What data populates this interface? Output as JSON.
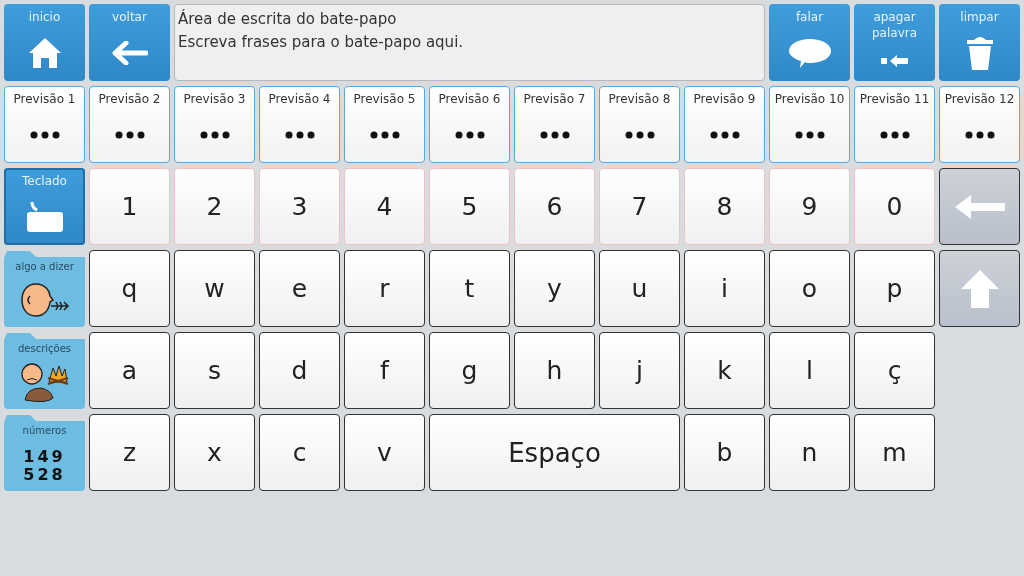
{
  "top_bar": {
    "left": [
      {
        "kind": "home",
        "label": "inicio"
      },
      {
        "kind": "back",
        "label": "voltar"
      }
    ],
    "chat_area": {
      "title": "Área de escrita do bate-papo",
      "placeholder": "Escreva frases para o bate-papo aqui."
    },
    "right": [
      {
        "kind": "speak",
        "label": "falar"
      },
      {
        "kind": "delete-word",
        "label": "apagar palavra"
      },
      {
        "kind": "clear",
        "label": "limpar"
      }
    ]
  },
  "predictions": [
    {
      "label": "Previsão 1"
    },
    {
      "label": "Previsão 2"
    },
    {
      "label": "Previsão 3"
    },
    {
      "label": "Previsão 4"
    },
    {
      "label": "Previsão 5"
    },
    {
      "label": "Previsão 6"
    },
    {
      "label": "Previsão 7"
    },
    {
      "label": "Previsão 8"
    },
    {
      "label": "Previsão 9"
    },
    {
      "label": "Previsão 10"
    },
    {
      "label": "Previsão 11"
    },
    {
      "label": "Previsão 12"
    }
  ],
  "side_menu": [
    {
      "kind": "keyboard",
      "label": "Teclado",
      "selected": true
    },
    {
      "kind": "say",
      "label": "algo a dizer",
      "selected": false
    },
    {
      "kind": "describe",
      "label": "descrições",
      "selected": false
    },
    {
      "kind": "numbers",
      "label": "números",
      "selected": false,
      "digits": [
        "149",
        "528"
      ]
    }
  ],
  "keyboard": [
    {
      "keys": [
        {
          "kind": "digit",
          "text": "1"
        },
        {
          "kind": "digit",
          "text": "2"
        },
        {
          "kind": "digit",
          "text": "3"
        },
        {
          "kind": "digit",
          "text": "4"
        },
        {
          "kind": "digit",
          "text": "5"
        },
        {
          "kind": "digit",
          "text": "6"
        },
        {
          "kind": "digit",
          "text": "7"
        },
        {
          "kind": "digit",
          "text": "8"
        },
        {
          "kind": "digit",
          "text": "9"
        },
        {
          "kind": "digit",
          "text": "0"
        },
        {
          "kind": "backspace"
        }
      ]
    },
    {
      "keys": [
        {
          "kind": "letter",
          "text": "q"
        },
        {
          "kind": "letter",
          "text": "w"
        },
        {
          "kind": "letter",
          "text": "e"
        },
        {
          "kind": "letter",
          "text": "r"
        },
        {
          "kind": "letter",
          "text": "t"
        },
        {
          "kind": "letter",
          "text": "y"
        },
        {
          "kind": "letter",
          "text": "u"
        },
        {
          "kind": "letter",
          "text": "i"
        },
        {
          "kind": "letter",
          "text": "o"
        },
        {
          "kind": "letter",
          "text": "p"
        },
        {
          "kind": "shift"
        }
      ]
    },
    {
      "keys": [
        {
          "kind": "letter",
          "text": "a"
        },
        {
          "kind": "letter",
          "text": "s"
        },
        {
          "kind": "letter",
          "text": "d"
        },
        {
          "kind": "letter",
          "text": "f"
        },
        {
          "kind": "letter",
          "text": "g"
        },
        {
          "kind": "letter",
          "text": "h"
        },
        {
          "kind": "letter",
          "text": "j"
        },
        {
          "kind": "letter",
          "text": "k"
        },
        {
          "kind": "letter",
          "text": "l"
        },
        {
          "kind": "letter",
          "text": "ç"
        }
      ]
    },
    {
      "keys": [
        {
          "kind": "letter",
          "text": "z"
        },
        {
          "kind": "letter",
          "text": "x"
        },
        {
          "kind": "letter",
          "text": "c"
        },
        {
          "kind": "letter",
          "text": "v"
        },
        {
          "kind": "space",
          "text": "Espaço"
        },
        {
          "kind": "letter",
          "text": "b"
        },
        {
          "kind": "letter",
          "text": "n"
        },
        {
          "kind": "letter",
          "text": "m"
        }
      ]
    }
  ]
}
